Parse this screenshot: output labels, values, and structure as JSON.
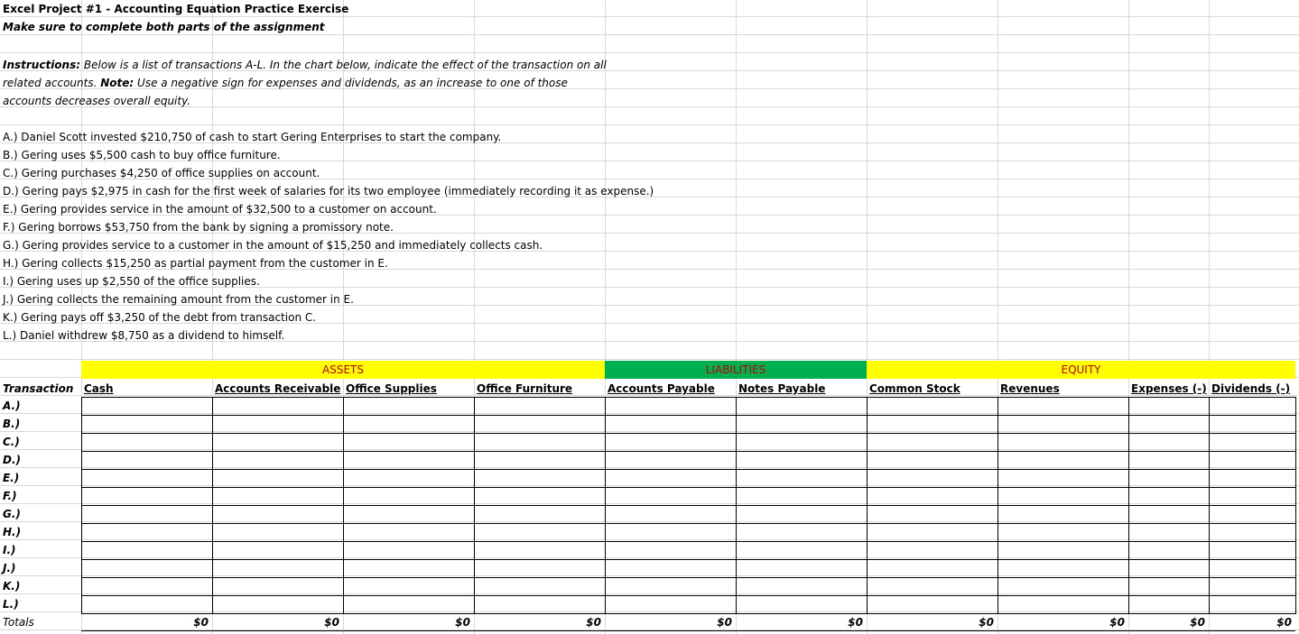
{
  "title": "Excel Project #1 - Accounting Equation Practice Exercise",
  "subtitle": "Make sure to complete both parts of the assignment",
  "instructions": {
    "label": "Instructions:",
    "line1": "Below is a list of transactions A-L. In the chart below, indicate the effect of the transaction on all",
    "line2_a": "related accounts.",
    "note_label": "Note:",
    "line2_b": "Use a negative sign for expenses and dividends, as an increase to one of those",
    "line3": "accounts decreases overall equity."
  },
  "transactions": [
    "A.) Daniel Scott invested $210,750 of cash to start Gering Enterprises to start the company.",
    "B.) Gering uses $5,500 cash to buy office furniture.",
    "C.) Gering purchases $4,250 of office supplies on account.",
    "D.) Gering pays $2,975 in cash for the first week of salaries for its two employee (immediately recording it as expense.)",
    "E.) Gering provides service in the amount of $32,500 to a customer on account.",
    "F.) Gering borrows $53,750 from the bank by signing a promissory note.",
    "G.) Gering provides service to a customer in the amount of $15,250 and immediately collects cash.",
    "H.) Gering collects $15,250 as partial payment from the customer in E.",
    "I.) Gering uses up $2,550 of the office supplies.",
    "J.) Gering collects the remaining amount from the customer in E.",
    "K.) Gering pays off $3,250 of the debt from transaction C.",
    "L.) Daniel withdrew $8,750 as a dividend to himself."
  ],
  "groups": {
    "assets": "ASSETS",
    "liabilities": "LIABILITIES",
    "equity": "EQUITY"
  },
  "colors": {
    "yellow": "#ffff00",
    "green": "#00b050",
    "group_text": "#c00000"
  },
  "table": {
    "transaction_header": "Transaction",
    "columns": [
      "Cash",
      "Accounts Receivable",
      "Office Supplies",
      "Office Furniture",
      "Accounts Payable",
      "Notes Payable",
      "Common Stock",
      "Revenues",
      "Expenses (-)",
      "Dividends (-)"
    ],
    "row_labels": [
      "A.)",
      "B.)",
      "C.)",
      "D.)",
      "E.)",
      "F.)",
      "G.)",
      "H.)",
      "I.)",
      "J.)",
      "K.)",
      "L.)"
    ],
    "totals_label": "Totals",
    "totals": [
      "$0",
      "$0",
      "$0",
      "$0",
      "$0",
      "$0",
      "$0",
      "$0",
      "$0",
      "$0"
    ]
  }
}
